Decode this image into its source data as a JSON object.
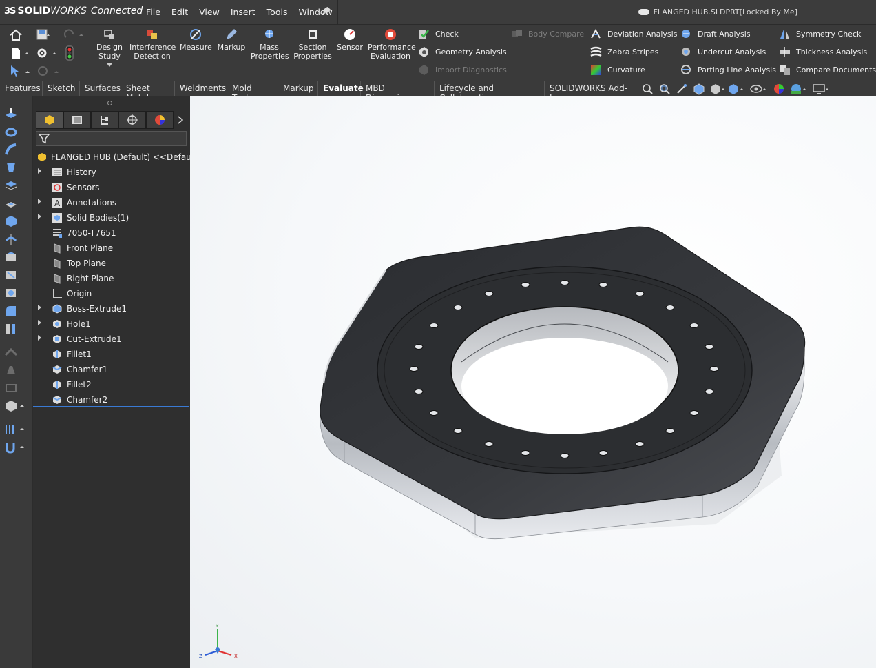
{
  "app": {
    "logo_ds": "3S",
    "logo_solid": "SOLID",
    "logo_works": "WORKS",
    "logo_connected": "Connected",
    "document_title": "FLANGED HUB.SLDPRT[Locked By Me]"
  },
  "menu": [
    "File",
    "Edit",
    "View",
    "Insert",
    "Tools",
    "Window"
  ],
  "command_manager": {
    "design_study": "Design\nStudy",
    "interference": "Interference\nDetection",
    "measure": "Measure",
    "markup": "Markup",
    "mass_properties": "Mass\nProperties",
    "section_properties": "Section\nProperties",
    "sensor": "Sensor",
    "performance": "Performance\nEvaluation",
    "check": "Check",
    "geometry_analysis": "Geometry Analysis",
    "import_diagnostics": "Import Diagnostics",
    "body_compare": "Body Compare",
    "deviation_analysis": "Deviation Analysis",
    "zebra_stripes": "Zebra Stripes",
    "curvature": "Curvature",
    "draft_analysis": "Draft Analysis",
    "undercut_analysis": "Undercut Analysis",
    "parting_line_analysis": "Parting Line Analysis",
    "symmetry_check": "Symmetry Check",
    "thickness_analysis": "Thickness Analysis",
    "compare_documents": "Compare Documents"
  },
  "tabs": [
    "Features",
    "Sketch",
    "Surfaces",
    "Sheet Metal",
    "Weldments",
    "Mold Tools",
    "Markup",
    "Evaluate",
    "MBD Dimensions",
    "Lifecycle and Collaboration",
    "SOLIDWORKS Add-Ins"
  ],
  "active_tab": "Evaluate",
  "feature_tree": {
    "root": "FLANGED HUB (Default) <<Default>_D",
    "items": [
      {
        "label": "History",
        "expandable": true
      },
      {
        "label": "Sensors",
        "expandable": false
      },
      {
        "label": "Annotations",
        "expandable": true
      },
      {
        "label": "Solid Bodies(1)",
        "expandable": true
      },
      {
        "label": "7050-T7651",
        "expandable": false
      },
      {
        "label": "Front Plane",
        "expandable": false
      },
      {
        "label": "Top Plane",
        "expandable": false
      },
      {
        "label": "Right Plane",
        "expandable": false
      },
      {
        "label": "Origin",
        "expandable": false
      },
      {
        "label": "Boss-Extrude1",
        "expandable": true
      },
      {
        "label": "Hole1",
        "expandable": true
      },
      {
        "label": "Cut-Extrude1",
        "expandable": true
      },
      {
        "label": "Fillet1",
        "expandable": false
      },
      {
        "label": "Chamfer1",
        "expandable": false
      },
      {
        "label": "Fillet2",
        "expandable": false
      },
      {
        "label": "Chamfer2",
        "expandable": false
      }
    ]
  },
  "triad": {
    "x": "X",
    "y": "Y",
    "z": "Z"
  },
  "colors": {
    "accent": "#3a7ad4",
    "chrome": "#3a3a3a",
    "part": "#2b2d30"
  }
}
